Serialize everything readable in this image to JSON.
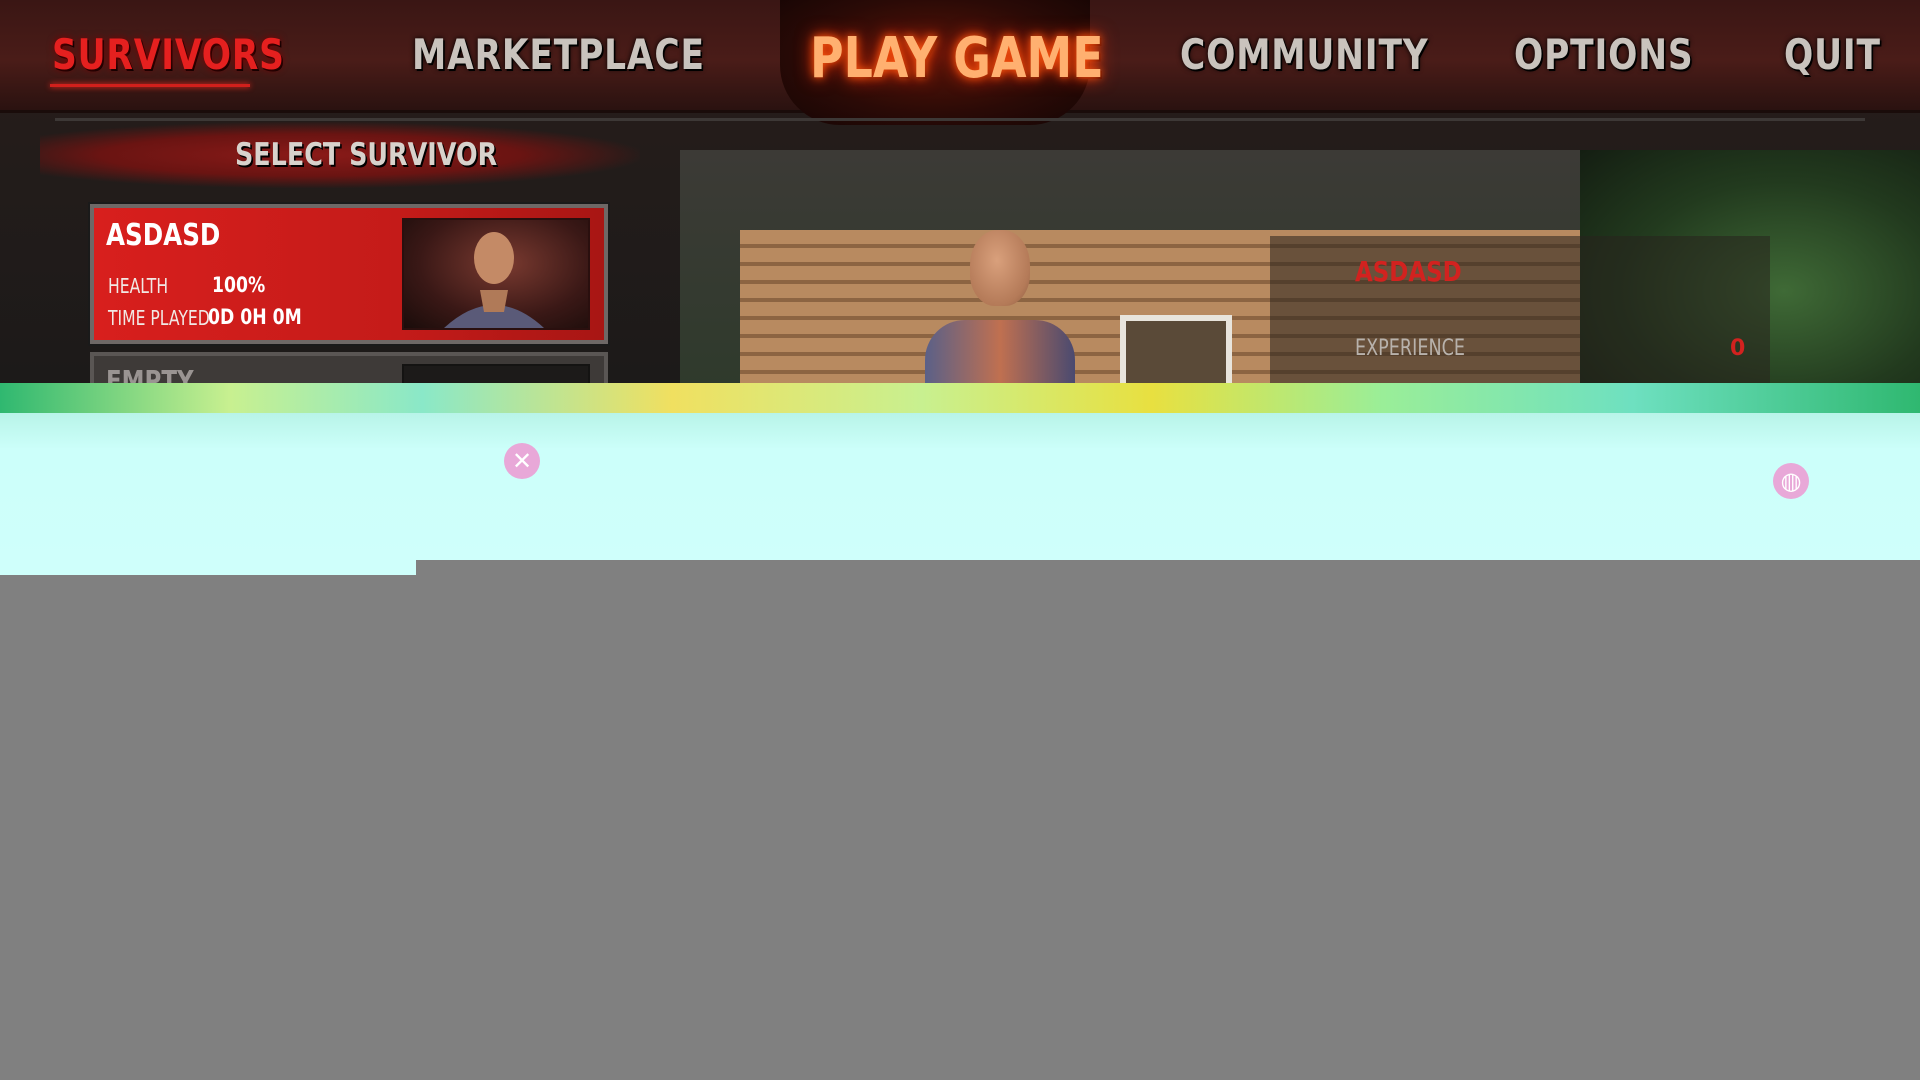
{
  "nav": {
    "survivors": "SURVIVORS",
    "marketplace": "MARKETPLACE",
    "play_game": "PLAY GAME",
    "community": "COMMUNITY",
    "options": "OPTIONS",
    "quit": "QUIT",
    "active_tab": "survivors"
  },
  "select_survivor": {
    "header": "SELECT SURVIVOR",
    "slots": [
      {
        "name": "ASDASD",
        "health_label": "HEALTH",
        "health_value": "100%",
        "time_played_label": "TIME PLAYED",
        "time_played_value": "0D 0H 0M",
        "selected": true
      },
      {
        "name": "EMPTY",
        "selected": false
      }
    ]
  },
  "survivor_panel": {
    "name": "ASDASD",
    "experience_label": "EXPERIENCE",
    "experience_value": "0"
  },
  "icons": {
    "close": "close-icon",
    "globe": "globe-icon"
  },
  "colors": {
    "accent_red": "#d81f1d",
    "play_game_glow": "#ff5a10",
    "glitch_gray": "#808080",
    "glitch_cyan": "#cffffb"
  }
}
